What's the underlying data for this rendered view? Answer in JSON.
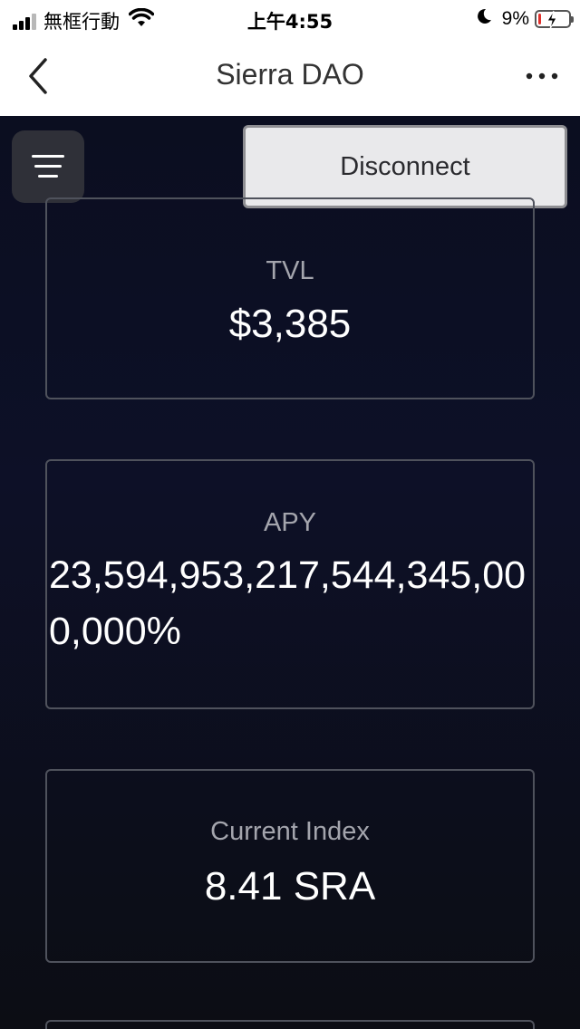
{
  "status_bar": {
    "carrier": "無框行動",
    "time": "上午4:55",
    "battery_percent": "9%",
    "battery_level": 0.09,
    "battery_color": "#e0302b"
  },
  "nav": {
    "title": "Sierra DAO",
    "back_icon": "chevron-left-icon",
    "more_icon": "ellipsis-icon"
  },
  "toolbar": {
    "menu_icon": "hamburger-menu-icon",
    "disconnect_label": "Disconnect"
  },
  "stats": {
    "tvl": {
      "label": "TVL",
      "value": "$3,385"
    },
    "apy": {
      "label": "APY",
      "value": "23,594,953,217,544,345,000,000%"
    },
    "current_index": {
      "label": "Current Index",
      "value": "8.41 SRA"
    }
  },
  "colors": {
    "background_top": "#0b0e20",
    "background_bottom": "#0c0d14",
    "card_border": "#4f525c",
    "label_text": "#a4a5ad",
    "value_text": "#ffffff",
    "button_background": "#e9e9eb"
  }
}
